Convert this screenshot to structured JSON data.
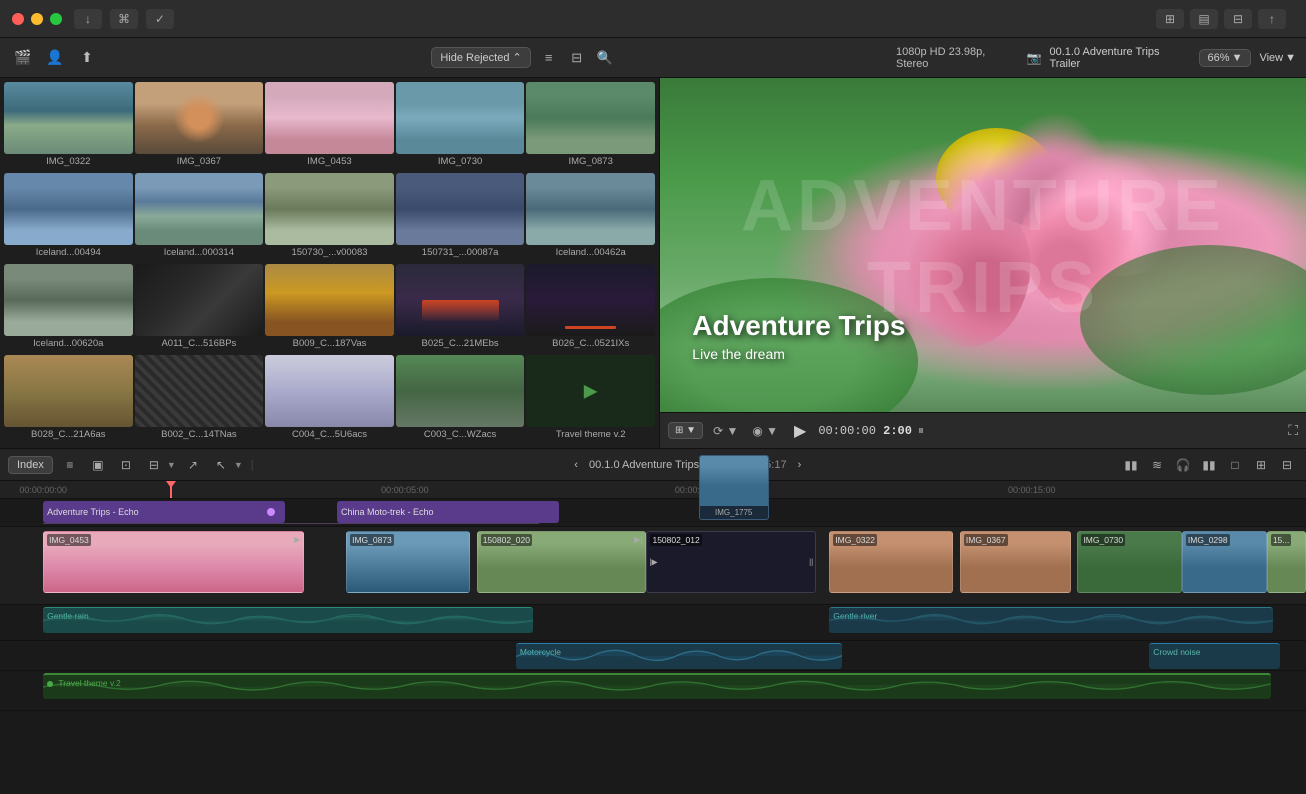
{
  "titlebar": {
    "traffic_lights": [
      "red",
      "yellow",
      "green"
    ],
    "buttons": [
      "download-icon",
      "key-icon",
      "check-icon",
      "grid-icon",
      "layout-icon",
      "columns-icon",
      "export-icon"
    ]
  },
  "toolbar": {
    "left_icons": [
      "film-icon",
      "person-icon",
      "share-icon"
    ],
    "hide_rejected_label": "Hide Rejected",
    "format": "1080p HD 23.98p, Stereo",
    "project": "00.1.0 Adventure Trips Trailer",
    "zoom": "66%",
    "view_label": "View"
  },
  "media_items": [
    {
      "id": "IMG_0322",
      "label": "IMG_0322",
      "thumb_class": "thumb-img0322"
    },
    {
      "id": "IMG_0367",
      "label": "IMG_0367",
      "thumb_class": "thumb-img0367"
    },
    {
      "id": "IMG_0453",
      "label": "IMG_0453",
      "thumb_class": "thumb-img0453"
    },
    {
      "id": "IMG_0730",
      "label": "IMG_0730",
      "thumb_class": "thumb-img0730"
    },
    {
      "id": "IMG_0873",
      "label": "IMG_0873",
      "thumb_class": "thumb-img0873"
    },
    {
      "id": "Iceland...00494",
      "label": "Iceland...00494",
      "thumb_class": "thumb-iceland494"
    },
    {
      "id": "Iceland...000314",
      "label": "Iceland...000314",
      "thumb_class": "thumb-iceland314"
    },
    {
      "id": "150730_...v00083",
      "label": "150730_...v00083",
      "thumb_class": "thumb-150730"
    },
    {
      "id": "150731_...00087a",
      "label": "150731_...00087a",
      "thumb_class": "thumb-150731"
    },
    {
      "id": "Iceland...00462a",
      "label": "Iceland...00462a",
      "thumb_class": "thumb-iceland462"
    },
    {
      "id": "Iceland...00620a",
      "label": "Iceland...00620a",
      "thumb_class": "thumb-iceland620"
    },
    {
      "id": "A011_C...516BPs",
      "label": "A011_C...516BPs",
      "thumb_class": "thumb-a011"
    },
    {
      "id": "B009_C...187Vas",
      "label": "B009_C...187Vas",
      "thumb_class": "thumb-b009"
    },
    {
      "id": "B025_C...21MEbs",
      "label": "B025_C...21MEbs",
      "thumb_class": "thumb-b025"
    },
    {
      "id": "B026_C...0521IXs",
      "label": "B026_C...0521IXs",
      "thumb_class": "thumb-b026"
    },
    {
      "id": "B028_C...21A6as",
      "label": "B028_C...21A6as",
      "thumb_class": "thumb-b028"
    },
    {
      "id": "B002_C...14TNas",
      "label": "B002_C...14TNas",
      "thumb_class": "thumb-b002"
    },
    {
      "id": "C004_C...5U6acs",
      "label": "C004_C...5U6acs",
      "thumb_class": "thumb-c004"
    },
    {
      "id": "C003_C...WZacs",
      "label": "C003_C...WZacs",
      "thumb_class": "thumb-c003"
    },
    {
      "id": "Travel theme v.2",
      "label": "Travel theme v.2",
      "thumb_class": "thumb-travel"
    }
  ],
  "preview": {
    "title": "Adventure Trips",
    "subtitle": "Live the dream",
    "bg_text": "Adventure Trips",
    "timecode": "00:00:00",
    "duration": "2:00",
    "zoom": "66%"
  },
  "timeline": {
    "index_label": "Index",
    "project_name": "00.1.0 Adventure Trips Trailer",
    "duration_display": "01:05:17",
    "rulers": [
      "00:00:00:00",
      "00:00:05:00",
      "00:00:10:00",
      "00:00:15:00"
    ],
    "tracks": {
      "audio_top": [
        {
          "label": "Adventure Trips - Echo",
          "start_pct": 3.3,
          "width_pct": 19,
          "color": "purple"
        },
        {
          "label": "China Moto-trek - Echo",
          "start_pct": 25.8,
          "width_pct": 16.8,
          "color": "purple"
        }
      ],
      "video_clips": [
        {
          "label": "IMG_0453",
          "start_pct": 3.3,
          "width_pct": 20.5,
          "color": "lotus"
        },
        {
          "label": "IMG_0873",
          "start_pct": 26.5,
          "width_pct": 19.5,
          "color": "mountain"
        },
        {
          "label": "150802_020",
          "start_pct": 36,
          "width_pct": 14,
          "color": "plain"
        },
        {
          "label": "150802_012",
          "start_pct": 49.5,
          "width_pct": 12,
          "color": "dark"
        },
        {
          "label": "IMG_0322",
          "start_pct": 63.5,
          "width_pct": 11,
          "color": "portrait"
        },
        {
          "label": "IMG_0367",
          "start_pct": 73.5,
          "width_pct": 8.5,
          "color": "portrait"
        },
        {
          "label": "IMG_0730",
          "start_pct": 82.5,
          "width_pct": 8,
          "color": "forest"
        },
        {
          "label": "IMG_0298",
          "start_pct": 90.5,
          "width_pct": 7,
          "color": "water"
        },
        {
          "label": "15...",
          "start_pct": 97,
          "width_pct": 3,
          "color": "plain"
        }
      ],
      "preview_thumb": {
        "label": "IMG_1775",
        "start_pct": 53.5,
        "width_pct": 9
      },
      "audio_gentle_rain": [
        {
          "label": "Gentle rain",
          "start_pct": 3.3,
          "width_pct": 38,
          "color": "teal"
        }
      ],
      "audio_gentle_river": [
        {
          "label": "Gentle river",
          "start_pct": 63.5,
          "width_pct": 34,
          "color": "teal2"
        }
      ],
      "audio_motorcycle": [
        {
          "label": "Motorcycle",
          "start_pct": 39.5,
          "width_pct": 25,
          "color": "moto"
        }
      ],
      "audio_crowd": [
        {
          "label": "Crowd noise",
          "start_pct": 88,
          "width_pct": 12,
          "color": "crowd"
        }
      ],
      "green_track": [
        {
          "label": "Travel theme v.2",
          "start_pct": 3.3,
          "width_pct": 94,
          "color": "green"
        }
      ]
    }
  }
}
